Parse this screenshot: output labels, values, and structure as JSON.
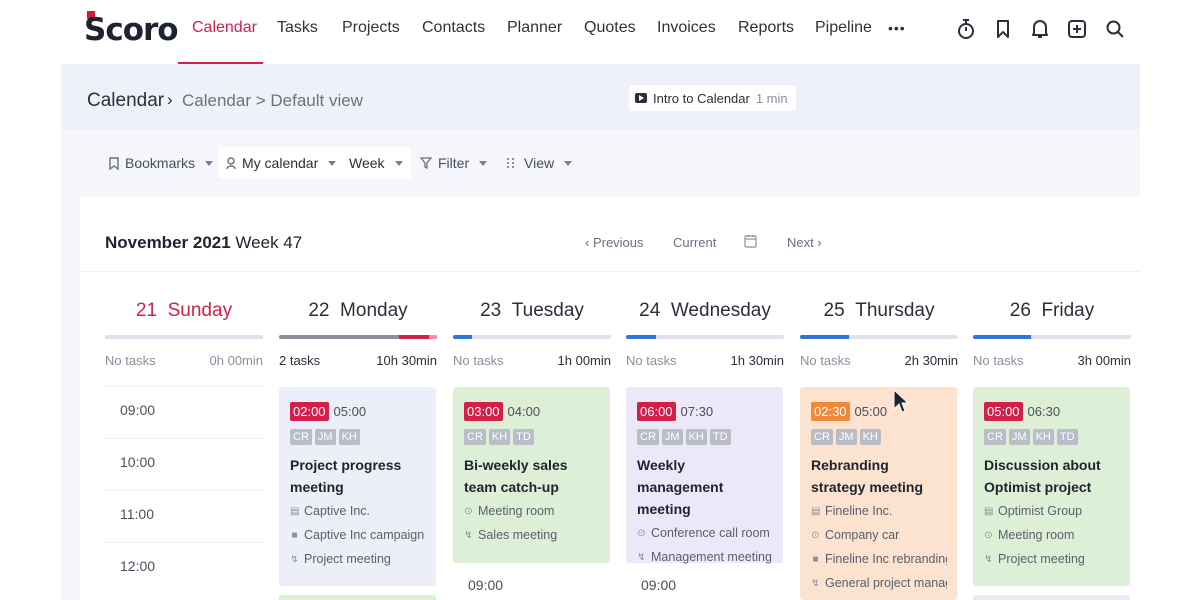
{
  "nav": {
    "logo": "Scoro",
    "items": [
      "Calendar",
      "Tasks",
      "Projects",
      "Contacts",
      "Planner",
      "Quotes",
      "Invoices",
      "Reports",
      "Pipeline"
    ],
    "more": "•••",
    "icons": [
      "timer-icon",
      "bookmark-icon",
      "bell-icon",
      "add-icon",
      "search-icon"
    ]
  },
  "breadcrumb": {
    "title": "Calendar",
    "separator": "›",
    "path": "Calendar > Default view"
  },
  "intro": {
    "label": "Intro to Calendar",
    "duration": "1 min"
  },
  "toolbar": {
    "bookmarks": "Bookmarks",
    "my_calendar": "My calendar",
    "week": "Week",
    "filter": "Filter",
    "view": "View"
  },
  "week": {
    "month": "November 2021",
    "week_label": "Week 47",
    "previous": "‹ Previous",
    "current": "Current",
    "next": "Next ›"
  },
  "days": [
    {
      "num": "21",
      "name": "Sunday",
      "tasks": "No tasks",
      "total": "0h 00min",
      "fill": 0
    },
    {
      "num": "22",
      "name": "Monday",
      "tasks": "2 tasks",
      "total": "10h 30min",
      "fill": 1
    },
    {
      "num": "23",
      "name": "Tuesday",
      "tasks": "No tasks",
      "total": "1h 00min",
      "fill": 0.12
    },
    {
      "num": "24",
      "name": "Wednesday",
      "tasks": "No tasks",
      "total": "1h 30min",
      "fill": 0.19
    },
    {
      "num": "25",
      "name": "Thursday",
      "tasks": "No tasks",
      "total": "2h 30min",
      "fill": 0.31
    },
    {
      "num": "26",
      "name": "Friday",
      "tasks": "No tasks",
      "total": "3h 00min",
      "fill": 0.37
    }
  ],
  "times": [
    "09:00",
    "10:00",
    "11:00",
    "12:00"
  ],
  "events": [
    {
      "start": "02:00",
      "end": "05:00",
      "badge_color": "#d2204a",
      "bg": "#eceefa",
      "attendees": [
        "CR",
        "JM",
        "KH"
      ],
      "title": "Project progress meeting",
      "lines": [
        {
          "icon": "building-icon",
          "text": "Captive Inc."
        },
        {
          "icon": "project-icon",
          "text": "Captive Inc campaign ..."
        },
        {
          "icon": "activity-icon",
          "text": "Project meeting"
        }
      ]
    },
    {
      "start": "03:00",
      "end": "04:00",
      "badge_color": "#d2204a",
      "bg": "#ddefd6",
      "attendees": [
        "CR",
        "KH",
        "TD"
      ],
      "title": "Bi-weekly sales team catch-up",
      "lines": [
        {
          "icon": "location-icon",
          "text": "Meeting room"
        },
        {
          "icon": "activity-icon",
          "text": "Sales meeting"
        }
      ]
    },
    {
      "start": "06:00",
      "end": "07:30",
      "badge_color": "#d2204a",
      "bg": "#ede8f8",
      "attendees": [
        "CR",
        "JM",
        "KH",
        "TD"
      ],
      "title": "Weekly management meeting",
      "lines": [
        {
          "icon": "location-icon",
          "text": "Conference call room"
        },
        {
          "icon": "activity-icon",
          "text": "Management meeting"
        }
      ]
    },
    {
      "start": "02:30",
      "end": "05:00",
      "badge_color": "#ef8a3c",
      "bg": "#fbe3cf",
      "attendees": [
        "CR",
        "JM",
        "KH"
      ],
      "title": "Rebranding strategy meeting",
      "lines": [
        {
          "icon": "building-icon",
          "text": "Fineline Inc."
        },
        {
          "icon": "location-icon",
          "text": "Company car"
        },
        {
          "icon": "project-icon",
          "text": "Fineline Inc rebranding"
        },
        {
          "icon": "activity-icon",
          "text": "General project manag..."
        }
      ]
    },
    {
      "start": "05:00",
      "end": "06:30",
      "badge_color": "#d2204a",
      "bg": "#ddefd6",
      "attendees": [
        "CR",
        "JM",
        "KH",
        "TD"
      ],
      "title": "Discussion about Optimist project",
      "lines": [
        {
          "icon": "building-icon",
          "text": "Optimist Group"
        },
        {
          "icon": "location-icon",
          "text": "Meeting room"
        },
        {
          "icon": "activity-icon",
          "text": "Project meeting"
        }
      ]
    }
  ],
  "below_times": [
    "09:00",
    "09:00"
  ]
}
